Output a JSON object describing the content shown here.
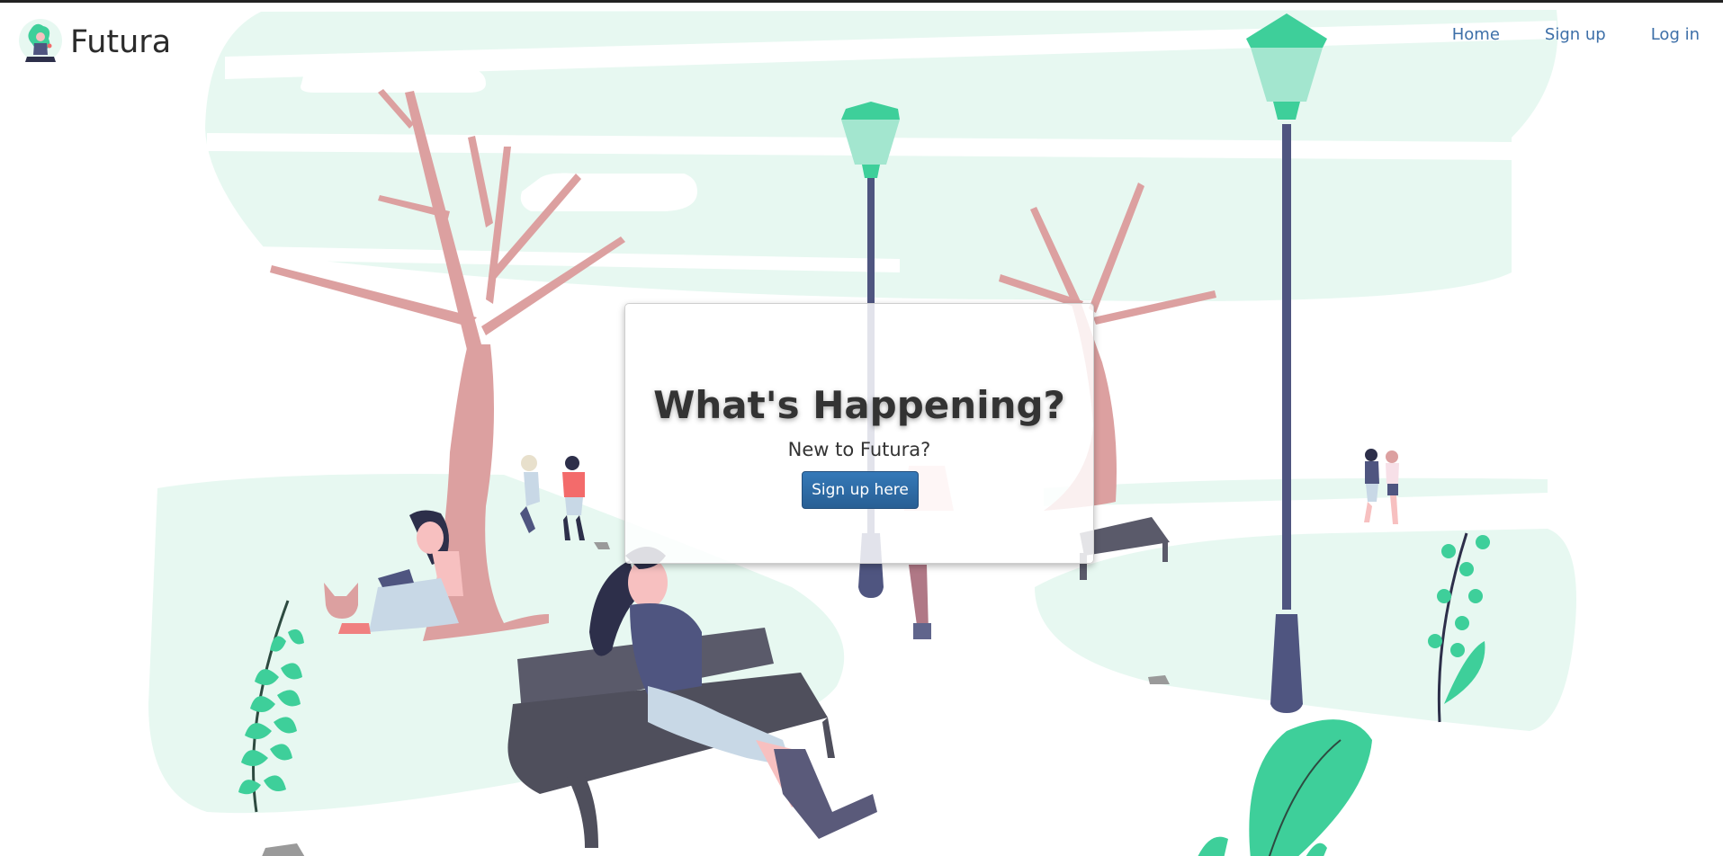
{
  "brand": {
    "name": "Futura",
    "logo_icon": "meditating-person-logo-icon"
  },
  "nav": {
    "items": [
      {
        "label": "Home"
      },
      {
        "label": "Sign up"
      },
      {
        "label": "Log in"
      }
    ]
  },
  "hero": {
    "title": "What's Happening?",
    "subtitle": "New to Futura?",
    "cta_label": "Sign up here"
  },
  "colors": {
    "accent_green": "#3ecf9a",
    "light_mint": "#e7f8f1",
    "tree_pink": "#dca0a0",
    "navy": "#4f5580",
    "link_blue": "#3d6fa8",
    "button_blue": "#2d6ca6"
  }
}
